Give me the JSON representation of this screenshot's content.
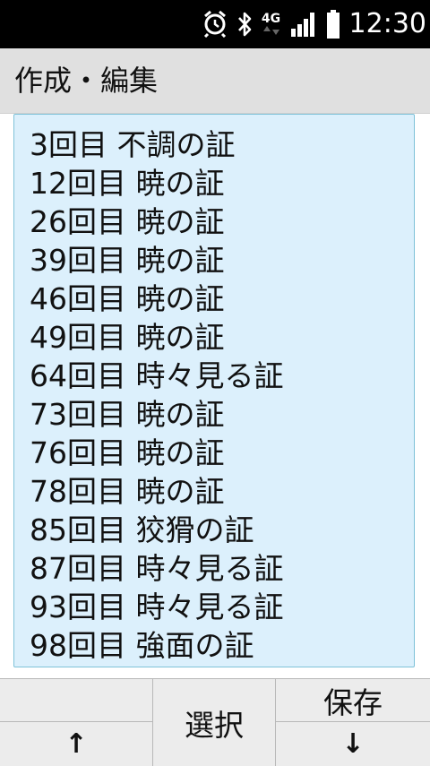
{
  "status_bar": {
    "network": "4G",
    "time": "12:30",
    "icons": [
      "alarm-icon",
      "bluetooth-icon",
      "network-4g-icon",
      "signal-icon",
      "battery-icon"
    ]
  },
  "app_bar": {
    "title": "作成・編集"
  },
  "list": {
    "items": [
      "3回目 不調の証",
      "12回目 暁の証",
      "26回目 暁の証",
      "39回目 暁の証",
      "46回目 暁の証",
      "49回目 暁の証",
      "64回目 時々見る証",
      "73回目 暁の証",
      "76回目 暁の証",
      "78回目 暁の証",
      "85回目 狡猾の証",
      "87回目 時々見る証",
      "93回目 時々見る証",
      "98回目 強面の証"
    ]
  },
  "softkeys": {
    "left_top": "",
    "up_arrow": "↑",
    "center": "選択",
    "right_top": "保存",
    "down_arrow": "↓"
  }
}
